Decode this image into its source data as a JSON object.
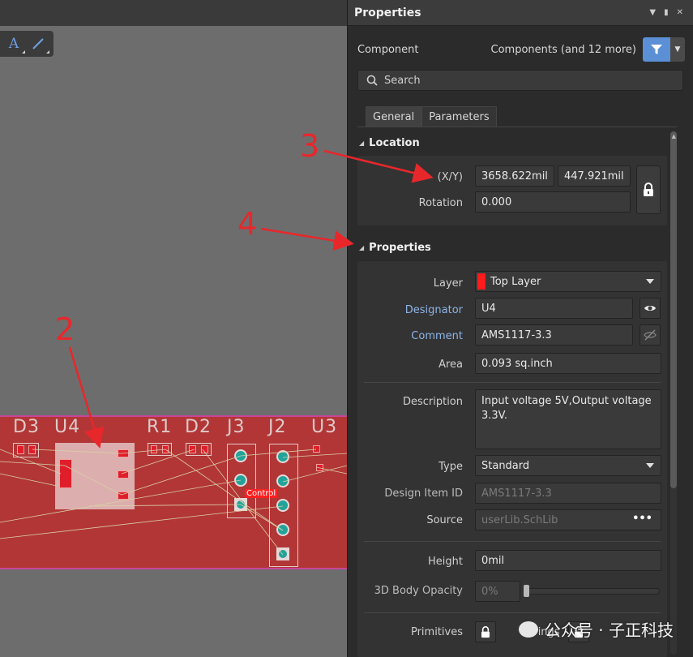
{
  "panel": {
    "title": "Properties",
    "filter_label": "Component",
    "filter_value": "Components (and 12 more)",
    "search_placeholder": "Search",
    "tabs": [
      {
        "label": "General"
      },
      {
        "label": "Parameters"
      }
    ]
  },
  "location": {
    "heading": "Location",
    "xy_label": "(X/Y)",
    "x_value": "3658.622mil",
    "y_value": "447.921mil",
    "rotation_label": "Rotation",
    "rotation_value": "0.000"
  },
  "properties": {
    "heading": "Properties",
    "layer_label": "Layer",
    "layer_value": "Top Layer",
    "layer_color": "#ff1b1b",
    "designator_label": "Designator",
    "designator_value": "U4",
    "comment_label": "Comment",
    "comment_value": "AMS1117-3.3",
    "area_label": "Area",
    "area_value": "0.093 sq.inch",
    "description_label": "Description",
    "description_value": "Input voltage 5V,Output voltage 3.3V.",
    "type_label": "Type",
    "type_value": "Standard",
    "design_item_label": "Design Item ID",
    "design_item_value": "AMS1117-3.3",
    "source_label": "Source",
    "source_value": "userLib.SchLib",
    "source_more": "•••",
    "height_label": "Height",
    "height_value": "0mil",
    "opacity_label": "3D Body Opacity",
    "opacity_value": "0%",
    "primitives_label": "Primitives",
    "strings_label": "Strings"
  },
  "pcb": {
    "refs": [
      "D3",
      "U4",
      "R1",
      "D2",
      "J3",
      "J2",
      "U3"
    ],
    "control_label": "Control",
    "board_color": "#b23636"
  },
  "annotations": [
    "2",
    "3",
    "4"
  ],
  "watermark": "公众号 · 子正科技",
  "colors": {
    "accent": "#5b8fd6",
    "annotation": "#e8272b"
  }
}
